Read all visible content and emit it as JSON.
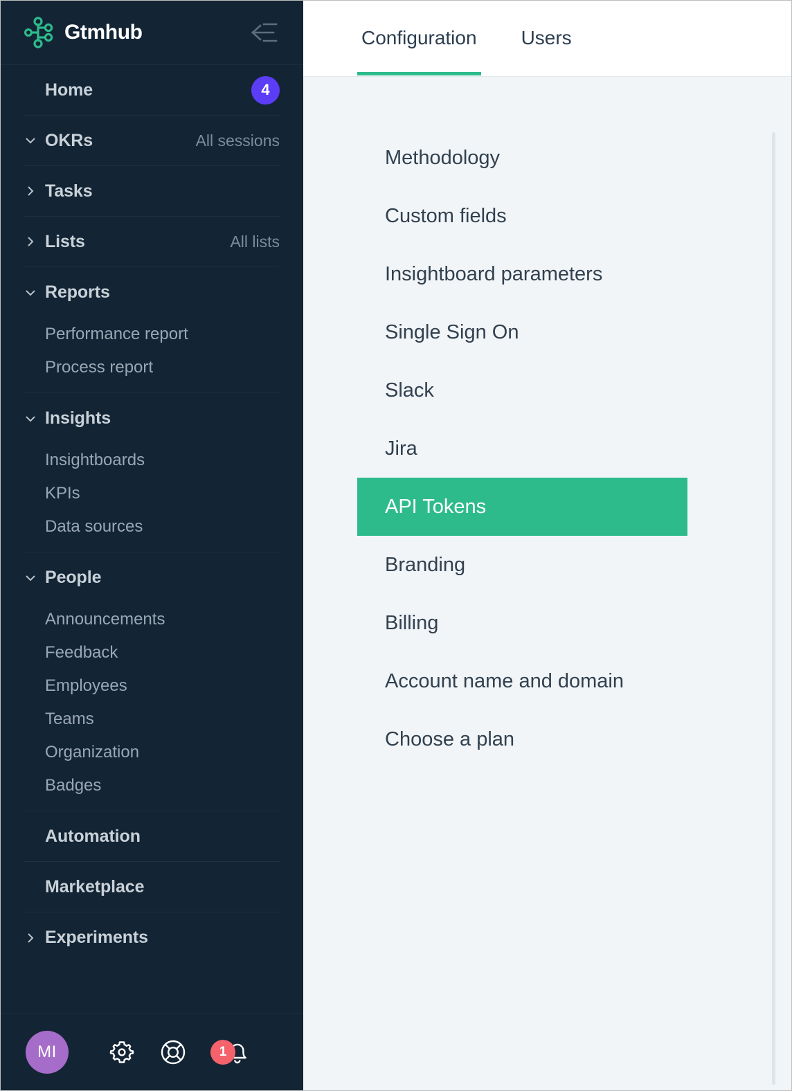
{
  "brand": {
    "name": "Gtmhub",
    "logo_icon": "node-graph-icon",
    "logo_color": "#2ebb8b",
    "collapse_icon": "collapse-sidebar-icon"
  },
  "sidebar": {
    "background": "#132434",
    "home": {
      "label": "Home",
      "badge": "4",
      "badge_color": "#5b3df5"
    },
    "groups": [
      {
        "label": "OKRs",
        "caret": "chevron-down-icon",
        "right_label": "All sessions",
        "items": []
      },
      {
        "label": "Tasks",
        "caret": "chevron-right-icon",
        "right_label": "",
        "items": []
      },
      {
        "label": "Lists",
        "caret": "chevron-right-icon",
        "right_label": "All lists",
        "items": []
      },
      {
        "label": "Reports",
        "caret": "chevron-down-icon",
        "right_label": "",
        "items": [
          "Performance report",
          "Process report"
        ]
      },
      {
        "label": "Insights",
        "caret": "chevron-down-icon",
        "right_label": "",
        "items": [
          "Insightboards",
          "KPIs",
          "Data sources"
        ]
      },
      {
        "label": "People",
        "caret": "chevron-down-icon",
        "right_label": "",
        "items": [
          "Announcements",
          "Feedback",
          "Employees",
          "Teams",
          "Organization",
          "Badges"
        ]
      },
      {
        "label": "Automation",
        "caret": "",
        "right_label": "",
        "items": []
      },
      {
        "label": "Marketplace",
        "caret": "",
        "right_label": "",
        "items": []
      },
      {
        "label": "Experiments",
        "caret": "chevron-right-icon",
        "right_label": "",
        "items": []
      }
    ],
    "footer": {
      "avatar_initials": "MI",
      "avatar_color": "#a66cc9",
      "settings_icon": "gear-icon",
      "help_icon": "life-ring-icon",
      "notifications_icon": "bell-icon",
      "notifications_badge": "1",
      "notifications_badge_color": "#f4626b"
    }
  },
  "main": {
    "tabs": [
      {
        "label": "Configuration",
        "active": true
      },
      {
        "label": "Users",
        "active": false
      }
    ],
    "accent_color": "#2ebb8b",
    "menu_items": [
      {
        "label": "Methodology",
        "selected": false
      },
      {
        "label": "Custom fields",
        "selected": false
      },
      {
        "label": "Insightboard parameters",
        "selected": false
      },
      {
        "label": "Single Sign On",
        "selected": false
      },
      {
        "label": "Slack",
        "selected": false
      },
      {
        "label": "Jira",
        "selected": false
      },
      {
        "label": "API Tokens",
        "selected": true
      },
      {
        "label": "Branding",
        "selected": false
      },
      {
        "label": "Billing",
        "selected": false
      },
      {
        "label": "Account name and domain",
        "selected": false
      },
      {
        "label": "Choose a plan",
        "selected": false
      }
    ]
  }
}
